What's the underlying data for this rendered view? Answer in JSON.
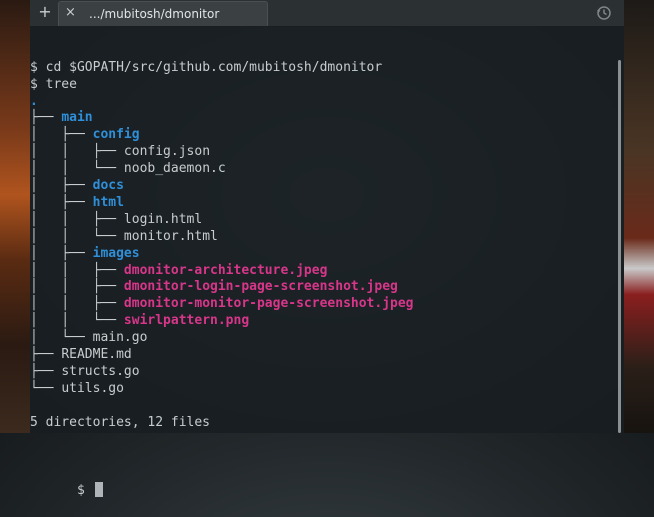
{
  "tabbar": {
    "new_tab_glyph": "+",
    "close_glyph": "×",
    "active_tab_title": ".../mubitosh/dmonitor"
  },
  "terminal": {
    "lines": [
      {
        "prefix": "$ ",
        "text": "cd $GOPATH/src/github.com/mubitosh/dmonitor",
        "style": "file"
      },
      {
        "prefix": "$ ",
        "text": "tree",
        "style": "file"
      },
      {
        "prefix": "",
        "text": ".",
        "style": "dot"
      },
      {
        "prefix": "├── ",
        "text": "main",
        "style": "dir"
      },
      {
        "prefix": "│   ├── ",
        "text": "config",
        "style": "dir"
      },
      {
        "prefix": "│   │   ├── ",
        "text": "config.json",
        "style": "file"
      },
      {
        "prefix": "│   │   └── ",
        "text": "noob_daemon.c",
        "style": "file"
      },
      {
        "prefix": "│   ├── ",
        "text": "docs",
        "style": "dir"
      },
      {
        "prefix": "│   ├── ",
        "text": "html",
        "style": "dir"
      },
      {
        "prefix": "│   │   ├── ",
        "text": "login.html",
        "style": "file"
      },
      {
        "prefix": "│   │   └── ",
        "text": "monitor.html",
        "style": "file"
      },
      {
        "prefix": "│   ├── ",
        "text": "images",
        "style": "dir"
      },
      {
        "prefix": "│   │   ├── ",
        "text": "dmonitor-architecture.jpeg",
        "style": "img"
      },
      {
        "prefix": "│   │   ├── ",
        "text": "dmonitor-login-page-screenshot.jpeg",
        "style": "img"
      },
      {
        "prefix": "│   │   ├── ",
        "text": "dmonitor-monitor-page-screenshot.jpeg",
        "style": "img"
      },
      {
        "prefix": "│   │   └── ",
        "text": "swirlpattern.png",
        "style": "img"
      },
      {
        "prefix": "│   └── ",
        "text": "main.go",
        "style": "file"
      },
      {
        "prefix": "├── ",
        "text": "README.md",
        "style": "file"
      },
      {
        "prefix": "├── ",
        "text": "structs.go",
        "style": "file"
      },
      {
        "prefix": "└── ",
        "text": "utils.go",
        "style": "file"
      },
      {
        "prefix": "",
        "text": "",
        "style": "file"
      },
      {
        "prefix": "",
        "text": "5 directories, 12 files",
        "style": "file"
      }
    ],
    "prompt": "$ "
  }
}
